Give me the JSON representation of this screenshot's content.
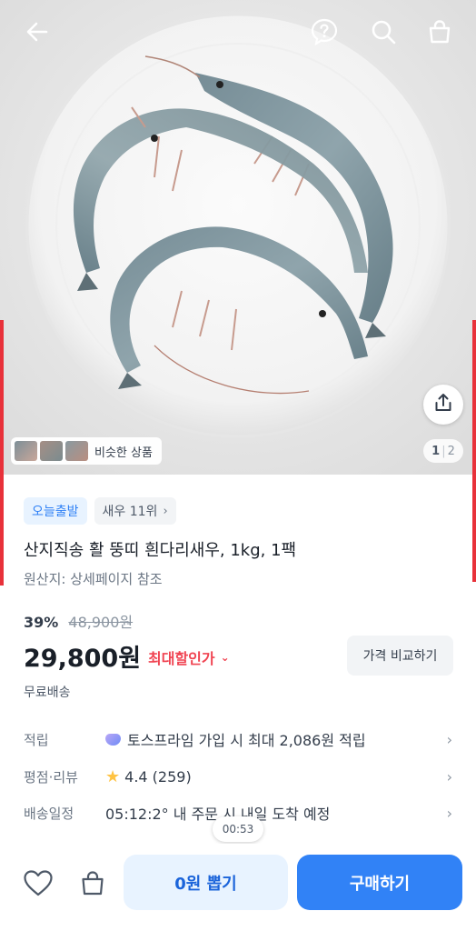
{
  "header": {
    "icons": [
      "back-arrow-icon",
      "help-icon",
      "search-icon",
      "cart-icon"
    ]
  },
  "gallery": {
    "page_current": "1",
    "page_total": "2",
    "similar_label": "비슷한 상품",
    "share_icon": "share-icon"
  },
  "product": {
    "badges": [
      {
        "label": "오늘출발"
      },
      {
        "label": "새우 11위",
        "chevron": "›"
      }
    ],
    "title": "산지직송 활 뚱띠 흰다리새우, 1kg, 1팩",
    "origin": "원산지: 상세페이지 참조",
    "discount_percent": "39%",
    "original_price": "48,900원",
    "price": "29,800원",
    "max_discount_label": "최대할인가",
    "max_discount_chevron": "⌄",
    "compare_button": "가격 비교하기",
    "shipping": "무료배송"
  },
  "details": [
    {
      "label": "적립",
      "value": "토스프라임 가입 시 최대 2,086원 적립",
      "icon": "gem-icon"
    },
    {
      "label": "평점·리뷰",
      "value": "4.4 (259)",
      "icon": "star-icon"
    },
    {
      "label": "배송일정",
      "value": "05:12:2° 내 주문 시 내일 도착 예정"
    }
  ],
  "timer": "00:53",
  "bottom_bar": {
    "coupon_button": "0원 뽑기",
    "buy_button": "구매하기"
  },
  "colors": {
    "accent": "#3182f6",
    "accent_light": "#e8f3ff",
    "discount_red": "#f04452",
    "edge_marker": "#e8313a"
  }
}
